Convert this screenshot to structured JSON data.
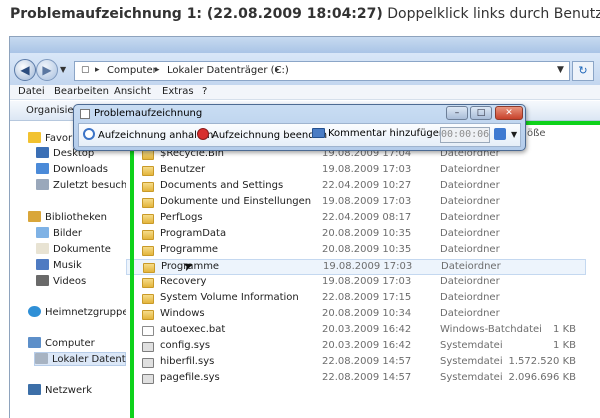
{
  "caption": {
    "title": "Problemaufzeichnung 1: (22.08.2009 18:04:27)",
    "text": " Doppelklick links durch Benutzer auf \"Name"
  },
  "addressbar": {
    "segments": [
      "Computer",
      "Lokaler Datenträger (C:)"
    ]
  },
  "menu": [
    "Datei",
    "Bearbeiten",
    "Ansicht",
    "Extras",
    "?"
  ],
  "toolbar": {
    "organize": "Organisieren"
  },
  "sidebar": {
    "items": [
      {
        "label": "Favoriten",
        "icon": "star-icon"
      },
      {
        "label": "Desktop",
        "icon": "desktop-icon"
      },
      {
        "label": "Downloads",
        "icon": "downloads-icon"
      },
      {
        "label": "Zuletzt besucht",
        "icon": "recent-icon"
      },
      {
        "label": "Bibliotheken",
        "icon": "library-icon"
      },
      {
        "label": "Bilder",
        "icon": "pictures-icon"
      },
      {
        "label": "Dokumente",
        "icon": "documents-icon"
      },
      {
        "label": "Musik",
        "icon": "music-icon"
      },
      {
        "label": "Videos",
        "icon": "videos-icon"
      },
      {
        "label": "Heimnetzgruppe",
        "icon": "homegroup-icon"
      },
      {
        "label": "Computer",
        "icon": "computer-icon"
      },
      {
        "label": "Lokaler Datenträger",
        "icon": "drive-icon"
      },
      {
        "label": "Netzwerk",
        "icon": "network-icon"
      }
    ]
  },
  "filelist": {
    "header_fragment": "öße",
    "rows": [
      {
        "name": "$Recycle.Bin",
        "date": "19.08.2009 17:04",
        "type": "Dateiordner",
        "size": "",
        "icon": "folder"
      },
      {
        "name": "Benutzer",
        "date": "19.08.2009 17:03",
        "type": "Dateiordner",
        "size": "",
        "icon": "folder"
      },
      {
        "name": "Documents and Settings",
        "date": "22.04.2009 10:27",
        "type": "Dateiordner",
        "size": "",
        "icon": "folder"
      },
      {
        "name": "Dokumente und Einstellungen",
        "date": "19.08.2009 17:03",
        "type": "Dateiordner",
        "size": "",
        "icon": "folder"
      },
      {
        "name": "PerfLogs",
        "date": "22.04.2009 08:17",
        "type": "Dateiordner",
        "size": "",
        "icon": "folder"
      },
      {
        "name": "ProgramData",
        "date": "20.08.2009 10:35",
        "type": "Dateiordner",
        "size": "",
        "icon": "folder"
      },
      {
        "name": "Programme",
        "date": "20.08.2009 10:35",
        "type": "Dateiordner",
        "size": "",
        "icon": "folder"
      },
      {
        "name": "Programme",
        "date": "19.08.2009 17:03",
        "type": "Dateiordner",
        "size": "",
        "icon": "folder"
      },
      {
        "name": "Recovery",
        "date": "19.08.2009 17:03",
        "type": "Dateiordner",
        "size": "",
        "icon": "folder"
      },
      {
        "name": "System Volume Information",
        "date": "22.08.2009 17:15",
        "type": "Dateiordner",
        "size": "",
        "icon": "folder"
      },
      {
        "name": "Windows",
        "date": "20.08.2009 10:34",
        "type": "Dateiordner",
        "size": "",
        "icon": "folder"
      },
      {
        "name": "autoexec.bat",
        "date": "20.03.2009 16:42",
        "type": "Windows-Batchdatei",
        "size": "1 KB",
        "icon": "file"
      },
      {
        "name": "config.sys",
        "date": "20.03.2009 16:42",
        "type": "Systemdatei",
        "size": "1 KB",
        "icon": "gear"
      },
      {
        "name": "hiberfil.sys",
        "date": "22.08.2009 14:57",
        "type": "Systemdatei",
        "size": "1.572.520 KB",
        "icon": "gear"
      },
      {
        "name": "pagefile.sys",
        "date": "22.08.2009 14:57",
        "type": "Systemdatei",
        "size": "2.096.696 KB",
        "icon": "gear"
      }
    ]
  },
  "psr": {
    "title": "Problemaufzeichnung",
    "pause_label": "Aufzeichnung anhalten",
    "stop_label": "Aufzeichnung beenden",
    "comment_label": "Kommentar hinzufügen",
    "timer": "00:00:06"
  },
  "colors": {
    "highlight": "#0ed21b",
    "close": "#c7412a"
  }
}
